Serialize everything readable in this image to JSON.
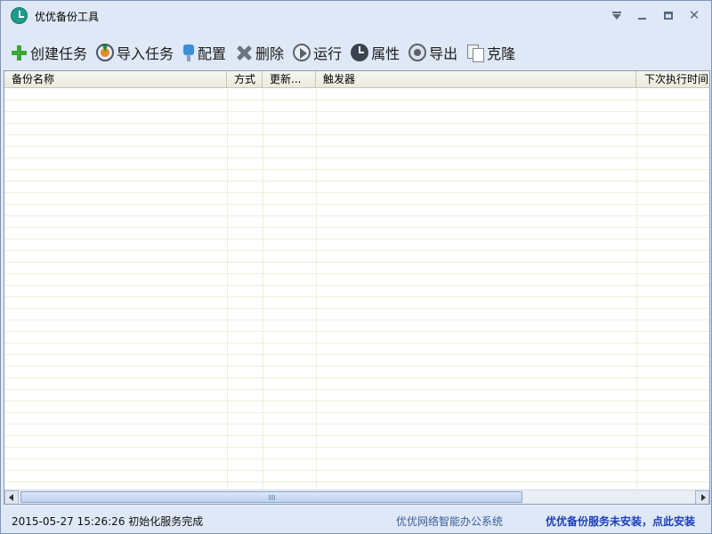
{
  "window": {
    "title": "优优备份工具"
  },
  "toolbar": {
    "items": [
      {
        "label": "创建任务",
        "icon": "plus-icon"
      },
      {
        "label": "导入任务",
        "icon": "import-icon"
      },
      {
        "label": "配置",
        "icon": "config-icon"
      },
      {
        "label": "删除",
        "icon": "delete-icon"
      },
      {
        "label": "运行",
        "icon": "run-icon"
      },
      {
        "label": "属性",
        "icon": "properties-icon"
      },
      {
        "label": "导出",
        "icon": "export-icon"
      },
      {
        "label": "克隆",
        "icon": "clone-icon"
      }
    ]
  },
  "table": {
    "columns": [
      "备份名称",
      "方式",
      "更新...",
      "触发器",
      "下次执行时间"
    ],
    "rows": []
  },
  "status": {
    "message": "2015-05-27 15:26:26 初始化服务完成",
    "center_link": "优优网络智能办公系统",
    "right_link": "优优备份服务未安装，点此安装"
  },
  "colors": {
    "window_bg": "#dfe8f6",
    "accent_icon": "#1f9a8b",
    "status_link": "#1a3fb8"
  }
}
